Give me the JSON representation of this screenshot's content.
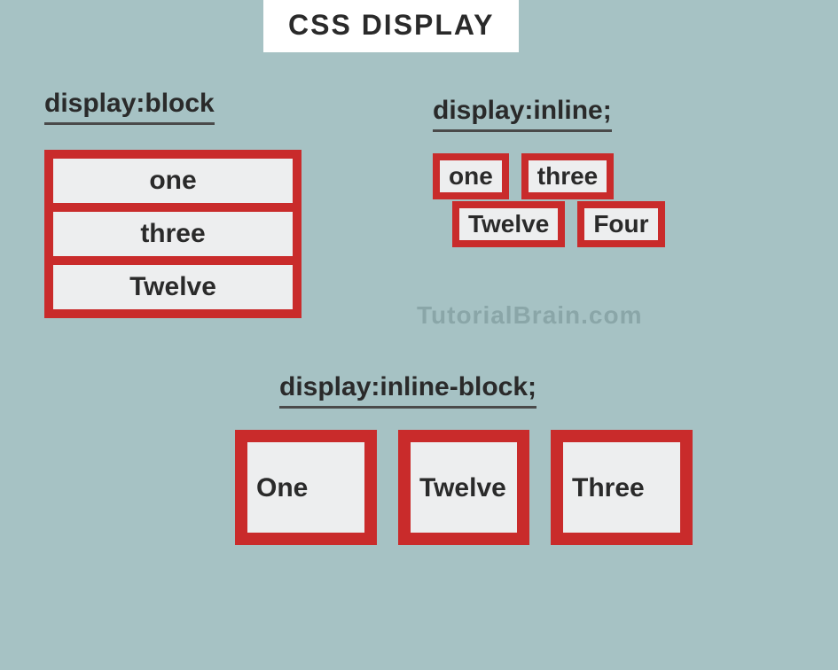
{
  "title": "CSS DISPLAY",
  "watermark": "TutorialBrain.com",
  "sections": {
    "block": {
      "heading": "display:block",
      "items": [
        "one",
        "three",
        "Twelve"
      ]
    },
    "inline": {
      "heading": "display:inline;",
      "row1": [
        "one",
        "three"
      ],
      "row2": [
        "Twelve",
        "Four"
      ]
    },
    "inlineBlock": {
      "heading": "display:inline-block;",
      "items": [
        "One",
        "Twelve",
        "Three"
      ]
    }
  }
}
